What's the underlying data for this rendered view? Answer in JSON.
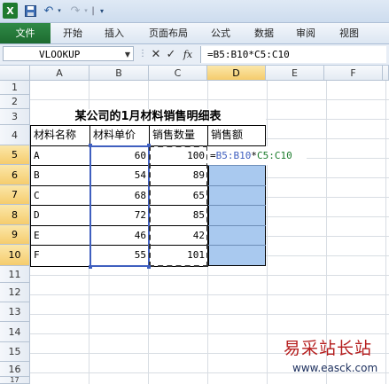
{
  "qat": {
    "app_icon": "X",
    "save_icon": "save-icon",
    "undo_icon": "↶",
    "redo_icon": "↷",
    "dropdown_glyph": "▾",
    "separator": "|",
    "customize_glyph": "▾"
  },
  "ribbon": {
    "tabs": [
      "文件",
      "开始",
      "插入",
      "页面布局",
      "公式",
      "数据",
      "审阅",
      "视图"
    ]
  },
  "formula_bar": {
    "name_box": "VLOOKUP",
    "cancel_glyph": "✕",
    "enter_glyph": "✓",
    "fx_label": "fx",
    "formula": "=B5:B10*C5:C10"
  },
  "grid": {
    "columns": [
      "A",
      "B",
      "C",
      "D",
      "E",
      "F"
    ],
    "rows": [
      "1",
      "2",
      "3",
      "4",
      "5",
      "6",
      "7",
      "8",
      "9",
      "10",
      "11",
      "12",
      "13",
      "14",
      "15",
      "16",
      "17"
    ],
    "title": "某公司的1月材料销售明细表",
    "headers": [
      "材料名称",
      "材料单价",
      "销售数量",
      "销售额"
    ],
    "data": [
      {
        "name": "A",
        "price": "60",
        "qty": "100"
      },
      {
        "name": "B",
        "price": "54",
        "qty": "89"
      },
      {
        "name": "C",
        "price": "68",
        "qty": "65"
      },
      {
        "name": "D",
        "price": "72",
        "qty": "85"
      },
      {
        "name": "E",
        "price": "46",
        "qty": "42"
      },
      {
        "name": "F",
        "price": "55",
        "qty": "101"
      }
    ],
    "edit_formula_prefix": "=",
    "edit_ref_a": "B5:B10",
    "edit_operator": "*",
    "edit_ref_b": "C5:C10"
  },
  "watermark": {
    "title": "易采站长站",
    "url": "www.easck.com"
  },
  "colors": {
    "file_tab": "#1d6b30",
    "selection_fill": "#a9c9ef",
    "ref_blue": "#3f5fbf",
    "ref_green": "#1c7c2c",
    "watermark_red": "#b51d1d"
  }
}
